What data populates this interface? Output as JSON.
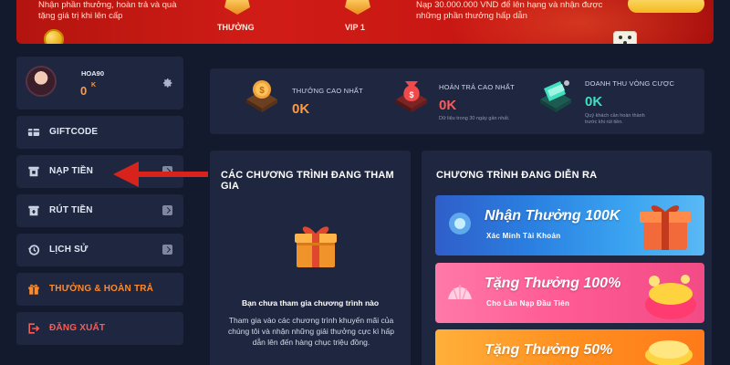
{
  "banner": {
    "left_text": "Nhận phần thưởng, hoàn trả và quà tặng giá trị khi lên cấp",
    "items": [
      {
        "label": "THƯỞNG"
      },
      {
        "label": "VIP 1"
      }
    ],
    "right_text": "Nạp 30.000.000 VND để lên hạng và nhận được những phần thưởng hấp dẫn"
  },
  "profile": {
    "username": "HOA90",
    "balance": "0",
    "balance_unit": "K"
  },
  "menu": [
    {
      "label": "GIFTCODE",
      "icon": "gift-card-icon"
    },
    {
      "label": "NẠP TIỀN",
      "icon": "deposit-icon"
    },
    {
      "label": "RÚT TIỀN",
      "icon": "withdraw-icon"
    },
    {
      "label": "LỊCH SỬ",
      "icon": "history-icon"
    },
    {
      "label": "THƯỞNG & HOÀN TRẢ",
      "icon": "reward-gift-icon",
      "active": true
    },
    {
      "label": "ĐĂNG XUẤT",
      "icon": "logout-icon"
    }
  ],
  "stats": [
    {
      "label": "THƯỞNG CAO NHẤT",
      "value": "0K",
      "note": ""
    },
    {
      "label": "HOÀN TRẢ CAO NHẤT",
      "value": "0K",
      "note": "Dữ liệu trong 30 ngày gần nhất."
    },
    {
      "label": "DOANH THU VÒNG CƯỢC",
      "value": "0K",
      "note": "Quý khách cần hoàn thành trước khi rút tiền."
    }
  ],
  "joined": {
    "title": "CÁC CHƯƠNG TRÌNH ĐANG THAM GIA",
    "empty_title": "Bạn chưa tham gia chương trình nào",
    "empty_desc": "Tham gia vào các chương trình khuyến mãi của chúng tôi và nhận những giải thưởng cực kì hấp dẫn lên đến hàng chục triệu đồng."
  },
  "ongoing": {
    "title": "CHƯƠNG TRÌNH ĐANG DIỄN RA",
    "promos": [
      {
        "title": "Nhận Thưởng 100K",
        "subtitle": "Xác Minh Tài Khoản"
      },
      {
        "title": "Tặng Thưởng 100%",
        "subtitle": "Cho Lần Nạp Đầu Tiên"
      },
      {
        "title": "Tặng Thưởng 50%",
        "subtitle": ""
      }
    ]
  },
  "colors": {
    "background": "#141a2e",
    "card": "#1f2640",
    "accent_orange": "#ff8a2a",
    "stat_orange": "#ff9a3d",
    "stat_red": "#ff5a5a",
    "stat_teal": "#3fe0c0",
    "logout_red": "#ff5a52",
    "arrow_red": "#d8231d"
  }
}
